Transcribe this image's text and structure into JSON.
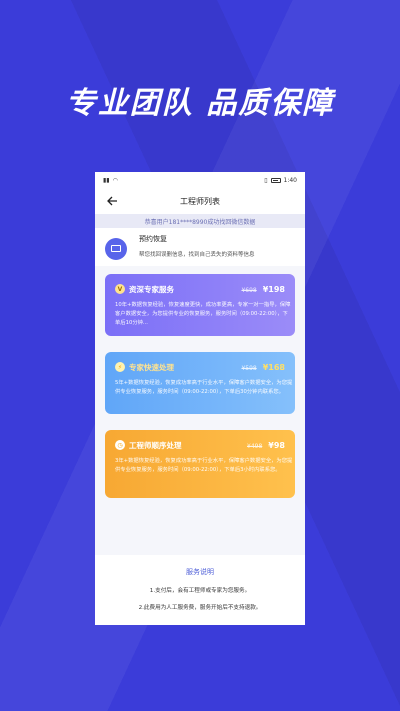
{
  "headline": "专业团队 品质保障",
  "status": {
    "time": "1:40"
  },
  "nav": {
    "title": "工程师列表"
  },
  "notice": "恭喜用户181****8990成功找回微信数据",
  "reserve": {
    "title": "预约恢复",
    "subtitle": "帮您找回误删信息，找到自己丢失的资料等信息"
  },
  "services": [
    {
      "title": "资深专家服务",
      "original_price": "¥698",
      "price": "¥198",
      "desc": "10年+数据恢复经验，恢复速度更快，成功率更高，专家一对一指导，保障客户数据安全，为您提供专业的恢复服务，服务时间（09:00-22:00），下单后10分钟..."
    },
    {
      "title": "专家快速处理",
      "original_price": "¥598",
      "price": "¥168",
      "desc": "5年+数据恢复经验，恢复成功率高于行业水平，保障客户数据安全，为您提供专业恢复服务，服务时间（09:00-22:00），下单后30分钟内联系您。"
    },
    {
      "title": "工程师顺序处理",
      "original_price": "¥498",
      "price": "¥98",
      "desc": "3年+数据恢复经验，恢复成功率高于行业水平，保障客户数据安全，为您提供专业恢复服务，服务时间（09:00-22:00），下单后3小时内联系您。"
    }
  ],
  "footer": {
    "title": "服务说明",
    "line1": "1.支付后，会有工程师或专家为您服务。",
    "line2": "2.此费用为人工服务费，服务开始后不支持退款。"
  },
  "colors": {
    "background": "#3b3cd9",
    "card1": "#7b6ff7",
    "card2": "#60a6f8",
    "card3": "#f7a833",
    "accent": "#5060d8"
  }
}
